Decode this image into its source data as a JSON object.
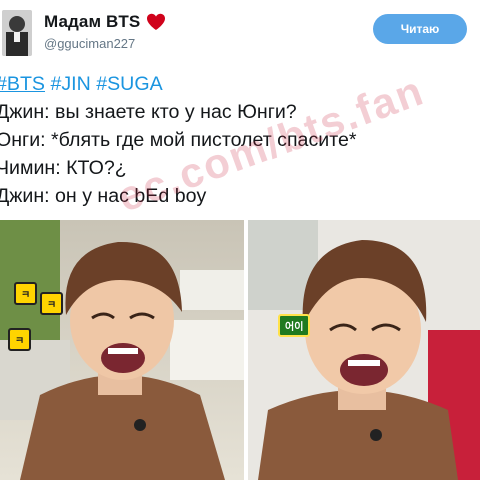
{
  "tweet": {
    "display_name": "Мадам BTS",
    "username": "@gguciman227",
    "follow_button_label": "Читаю",
    "hashtags": [
      "#BTS",
      "#JIN",
      "#SUGA"
    ],
    "lines": [
      "Джин: вы знаете кто у нас Юнги?",
      "Онги: *блять где мой пистолет спасите*",
      "Чимин: КТО?¿",
      "Джин: он у нас bEd boy"
    ]
  },
  "watermark_text": "ec.com/bts.fan",
  "photos": [
    {
      "description_icon": "laughing-man-photo",
      "stickers": [
        "ㅋ",
        "ㅋ",
        "ㅋ"
      ]
    },
    {
      "description_icon": "laughing-man-photo",
      "stickers": [
        "어이"
      ]
    }
  ],
  "colors": {
    "link": "#1b95e0",
    "follow_button": "#5aa7e8",
    "heart": "#d0021b",
    "text": "#14171a",
    "username": "#657786"
  }
}
